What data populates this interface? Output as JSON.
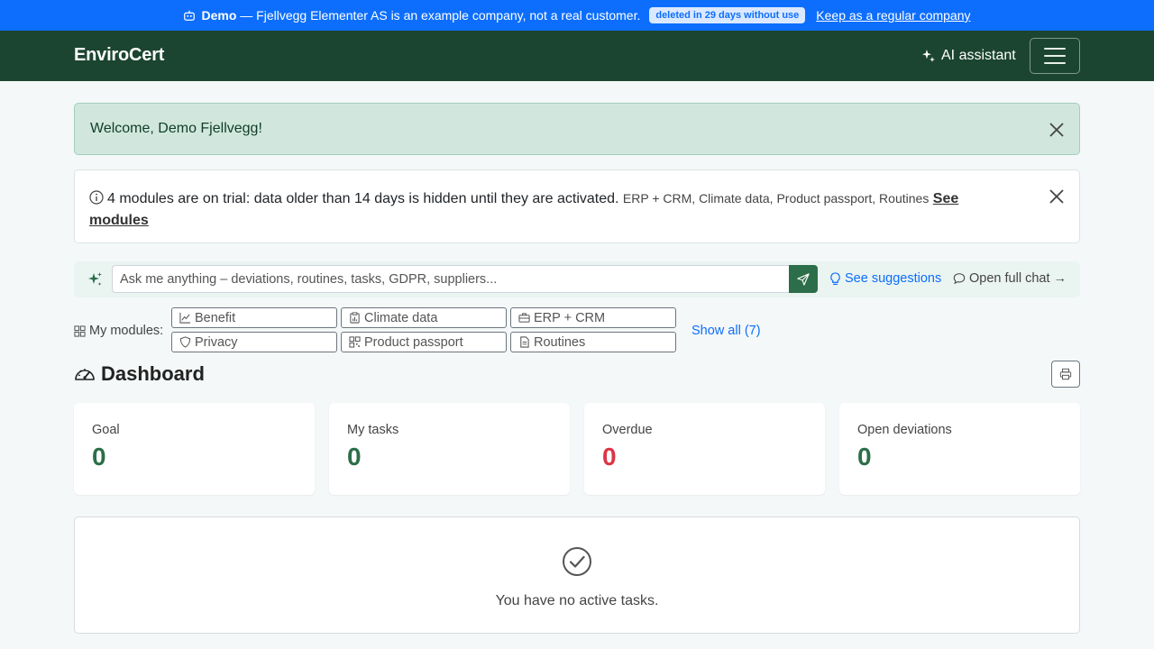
{
  "demo_banner": {
    "badge": "Demo",
    "message": " — Fjellvegg Elementer AS is an example company, not a real customer.",
    "pill": "deleted in 29 days without use",
    "link": "Keep as a regular company"
  },
  "navbar": {
    "brand": "EnviroCert",
    "ai_label": "AI assistant"
  },
  "welcome_alert": {
    "text": "Welcome, Demo Fjellvegg!"
  },
  "trial_alert": {
    "main": "4 modules are on trial: data older than 14 days is hidden until they are activated.",
    "modules": "ERP + CRM, Climate data, Product passport, Routines",
    "link": "See modules"
  },
  "ask": {
    "placeholder": "Ask me anything – deviations, routines, tasks, GDPR, suppliers...",
    "suggestions": "See suggestions",
    "open_chat": "Open full chat →"
  },
  "modules": {
    "label": "My modules:",
    "items": [
      {
        "label": "Benefit",
        "icon": "chart-line-icon"
      },
      {
        "label": "Climate data",
        "icon": "clipboard-data-icon"
      },
      {
        "label": "ERP + CRM",
        "icon": "briefcase-icon"
      },
      {
        "label": "Privacy",
        "icon": "shield-icon"
      },
      {
        "label": "Product passport",
        "icon": "qr-code-icon"
      },
      {
        "label": "Routines",
        "icon": "document-icon"
      }
    ],
    "show_all": "Show all (7)"
  },
  "dashboard": {
    "title": "Dashboard",
    "stats": [
      {
        "label": "Goal",
        "value": "0",
        "color": "#2c6e49"
      },
      {
        "label": "My tasks",
        "value": "0",
        "color": "#2c6e49"
      },
      {
        "label": "Overdue",
        "value": "0",
        "color": "#dc3545"
      },
      {
        "label": "Open deviations",
        "value": "0",
        "color": "#2c6e49"
      }
    ],
    "empty_tasks": "You have no active tasks."
  },
  "colors": {
    "banner": "#0d6efd",
    "navbar": "#1b4530",
    "accent": "#2c6e49",
    "danger": "#dc3545"
  }
}
